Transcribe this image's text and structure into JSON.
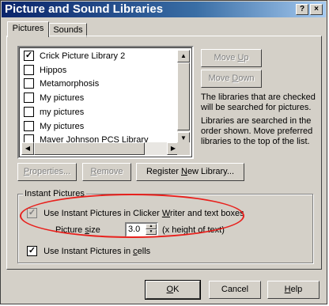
{
  "window": {
    "title": "Picture and Sound Libraries",
    "help_btn": "?",
    "close_btn": "×"
  },
  "tabs": [
    {
      "label": "Pictures",
      "active": true
    },
    {
      "label": "Sounds",
      "active": false
    }
  ],
  "library_list": {
    "items": [
      {
        "label": "Crick Picture Library 2",
        "checked": true,
        "mark": "✓"
      },
      {
        "label": "Hippos",
        "checked": false,
        "mark": ""
      },
      {
        "label": "Metamorphosis",
        "checked": false,
        "mark": ""
      },
      {
        "label": "My pictures",
        "checked": false,
        "mark": ""
      },
      {
        "label": "my pictures",
        "checked": false,
        "mark": ""
      },
      {
        "label": "My pictures",
        "checked": false,
        "mark": ""
      },
      {
        "label": "Mayer Johnson PCS Library",
        "checked": false,
        "mark": ""
      }
    ]
  },
  "side_buttons": {
    "move_up": {
      "pre": "Move ",
      "key": "U",
      "post": "p"
    },
    "move_down": {
      "pre": "Move ",
      "key": "D",
      "post": "own"
    }
  },
  "info_text": {
    "line1": "The libraries that are checked will be searched for pictures.",
    "line2": "Libraries are searched in the order shown. Move preferred libraries to the top of the list."
  },
  "action_buttons": {
    "properties": {
      "pre": "",
      "key": "P",
      "post": "roperties..."
    },
    "remove": {
      "pre": "",
      "key": "R",
      "post": "emove"
    },
    "register": {
      "pre": "Register ",
      "key": "N",
      "post": "ew Library..."
    }
  },
  "instant_pictures": {
    "group_title": "Instant Pictures",
    "use_in_writer": {
      "pre": "Use Instant Pictures in Clicker ",
      "key": "W",
      "post": "riter and text boxes",
      "checked": true,
      "mark": "✓"
    },
    "picture_size_label": {
      "pre": "Picture ",
      "key": "s",
      "post": "ize"
    },
    "picture_size_value": "3.0",
    "picture_size_unit": "(x height of text)",
    "use_in_cells": {
      "pre": "Use Instant Pictures in ",
      "key": "c",
      "post": "ells",
      "checked": true,
      "mark": "✓"
    }
  },
  "footer_buttons": {
    "ok": {
      "pre": "",
      "key": "O",
      "post": "K"
    },
    "cancel": {
      "label": "Cancel"
    },
    "help": {
      "pre": "",
      "key": "H",
      "post": "elp"
    }
  },
  "colors": {
    "titlebar": "#0a246a",
    "annotation_circle": "#e8201c",
    "dialog_face": "#d4d0c8"
  }
}
